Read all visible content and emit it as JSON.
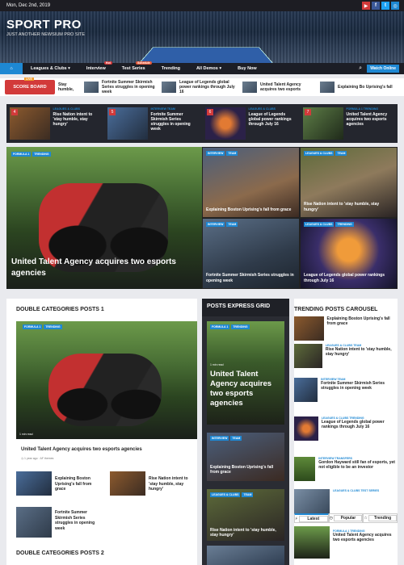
{
  "topbar": {
    "date": "Mon, Dec 2nd, 2019"
  },
  "brand": {
    "name": "SPORT PRO",
    "tagline": "JUST ANOTHER NEWSIUM PRO SITE"
  },
  "nav": {
    "items": [
      {
        "label": "Leagues & Clubs"
      },
      {
        "label": "Interview",
        "badge": "Hot"
      },
      {
        "label": "Test Series",
        "badge": "Schedule"
      },
      {
        "label": "Trending"
      },
      {
        "label": "All Demos"
      },
      {
        "label": "Buy Now"
      }
    ],
    "watch": "Watch Online"
  },
  "ticker": {
    "label": "SCORE BOARD",
    "live": "LIVE",
    "items": [
      "Stay humble,",
      "Fortnite Summer Skirmish Series struggles in opening week",
      "League of Legends global power rankings through July 16",
      "United Talent Agency acquires two esports",
      "Explaining Bo Uprising's fall"
    ]
  },
  "strip": [
    {
      "num": "4",
      "cat": "LEAGUES & CLUBS",
      "title": "Rise Nation intent to 'stay humble, stay hungry'"
    },
    {
      "num": "5",
      "cat": "INTERVIEW TEAM",
      "title": "Fortnite Summer Skirmish Series struggles in opening week"
    },
    {
      "num": "6",
      "cat": "LEAGUES & CLUBS",
      "title": "League of Legends global power rankings through July 16"
    },
    {
      "num": "7",
      "cat": "FORMULA 1 TRENDING",
      "title": "United Talent Agency acquires two esports agencies"
    }
  ],
  "grid": {
    "big": {
      "tags": [
        "FORMULA 1",
        "TRENDING"
      ],
      "title": "United Talent Agency acquires two esports agencies"
    },
    "tiles": [
      {
        "tags": [
          "INTERVIEW",
          "TEAM"
        ],
        "title": "Explaining Boston Uprising's fall from grace"
      },
      {
        "tags": [
          "LEAGUES & CLUBS",
          "TEAM"
        ],
        "title": "Rise Nation intent to 'stay humble, stay hungry'"
      },
      {
        "tags": [
          "INTERVIEW",
          "TEAM"
        ],
        "title": "Fortnite Summer Skirmish Series struggles in opening week"
      },
      {
        "tags": [
          "LEAGUES & CLUBS",
          "TRENDING"
        ],
        "title": "League of Legends global power rankings through July 16"
      }
    ]
  },
  "double1": {
    "title": "DOUBLE CATEGORIES POSTS 1",
    "feature": {
      "tags": [
        "FORMULA 1",
        "TRENDING"
      ],
      "title": "United Talent Agency acquires two esports agencies",
      "meta": "1 year ago",
      "meta2": "AF themes",
      "read": "1 min read"
    },
    "mini": [
      {
        "title": "Explaining Boston Uprising's fall from grace"
      },
      {
        "title": "Rise Nation intent to 'stay humble, stay hungry'"
      },
      {
        "title": "Fortnite Summer Skirmish Series struggles in opening week"
      }
    ]
  },
  "express": {
    "title": "POSTS EXPRESS GRID",
    "feature": {
      "tags": [
        "FORMULA 1",
        "TRENDING"
      ],
      "title": "United Talent Agency acquires two esports agencies",
      "read": "1 min read"
    },
    "items": [
      {
        "tags": [
          "INTERVIEW",
          "TEAM"
        ],
        "title": "Explaining Boston Uprising's fall from grace"
      },
      {
        "tags": [
          "LEAGUES & CLUBS",
          "TEAM"
        ],
        "title": "Rise Nation intent to 'stay humble, stay hungry'"
      }
    ]
  },
  "carousel": {
    "title": "TRENDING POSTS CAROUSEL",
    "items": [
      {
        "cat": "",
        "title": "Explaining Boston Uprising's fall from grace"
      },
      {
        "cat": "LEAGUES & CLUBS TEAM",
        "title": "Rise Nation intent to 'stay humble, stay hungry'"
      },
      {
        "cat": "INTERVIEW TEAM",
        "title": "Fortnite Summer Skirmish Series struggles in opening week"
      },
      {
        "cat": "LEAGUES & CLUBS TRENDING",
        "title": "League of Legends global power rankings through July 16"
      },
      {
        "cat": "INTERVIEW TRANSFERS",
        "title": "Gordon Hayward still fan of esports, yet not eligible to be an investor"
      },
      {
        "cat": "LEAGUES & CLUBS TEST SERIES",
        "title": ""
      }
    ],
    "tabs": [
      "Latest",
      "Popular",
      "Trending"
    ],
    "tabItem": {
      "cat": "FORMULA 1 TRENDING",
      "title": "United Talent Agency acquires two esports agencies"
    }
  },
  "double2": {
    "title": "DOUBLE CATEGORIES POSTS 2"
  }
}
